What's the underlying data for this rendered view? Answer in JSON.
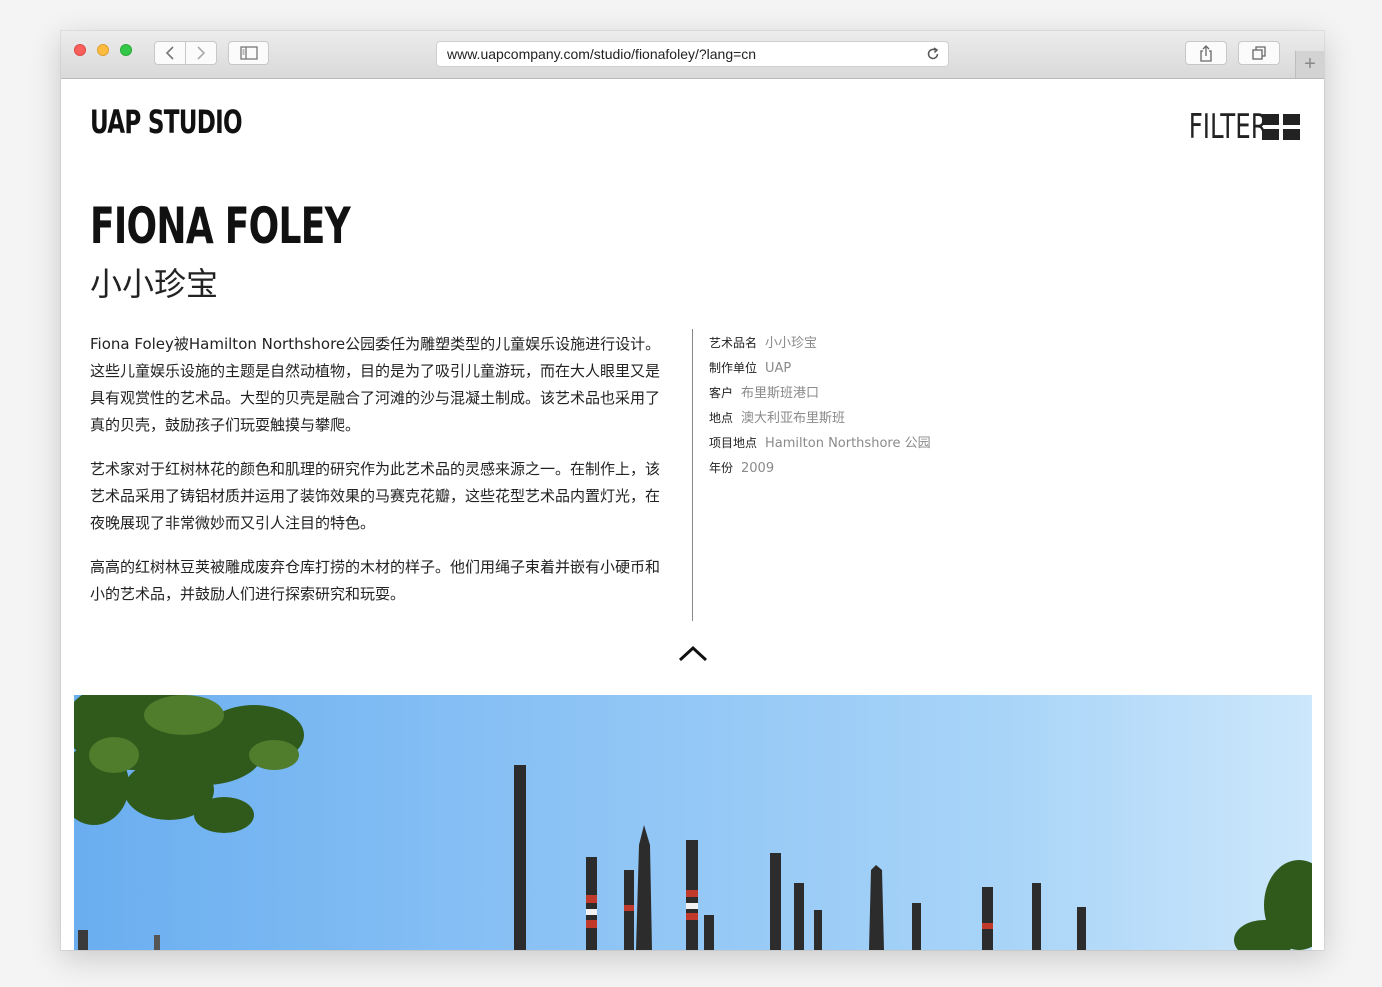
{
  "browser": {
    "url": "www.uapcompany.com/studio/fionafoley/?lang=cn",
    "new_tab_label": "+"
  },
  "header": {
    "logo": "UAP STUDIO",
    "filter_label": "FILTER"
  },
  "project": {
    "title": "FIONA FOLEY",
    "subtitle": "小小珍宝",
    "paragraphs": [
      "Fiona Foley被Hamilton Northshore公园委任为雕塑类型的儿童娱乐设施进行设计。这些儿童娱乐设施的主题是自然动植物，目的是为了吸引儿童游玩，而在大人眼里又是具有观赏性的艺术品。大型的贝壳是融合了河滩的沙与混凝土制成。该艺术品也采用了真的贝壳，鼓励孩子们玩耍触摸与攀爬。",
      "艺术家对于红树林花的颜色和肌理的研究作为此艺术品的灵感来源之一。在制作上，该艺术品采用了铸铝材质并运用了装饰效果的马赛克花瓣，这些花型艺术品内置灯光，在夜晚展现了非常微妙而又引人注目的特色。",
      "高高的红树林豆荚被雕成废弃仓库打捞的木材的样子。他们用绳子束着并嵌有小硬币和小的艺术品，并鼓励人们进行探索研究和玩耍。"
    ],
    "meta": [
      {
        "label": "艺术品名",
        "value": "小小珍宝"
      },
      {
        "label": "制作单位",
        "value": "UAP"
      },
      {
        "label": "客户",
        "value": "布里斯班港口"
      },
      {
        "label": "地点",
        "value": "澳大利亚布里斯班"
      },
      {
        "label": "项目地点",
        "value": "Hamilton Northshore 公园"
      },
      {
        "label": "年份",
        "value": "2009"
      }
    ]
  },
  "colors": {
    "text": "#222222",
    "meta_value": "#8a8a8a",
    "sky": "#8cc3f5"
  }
}
